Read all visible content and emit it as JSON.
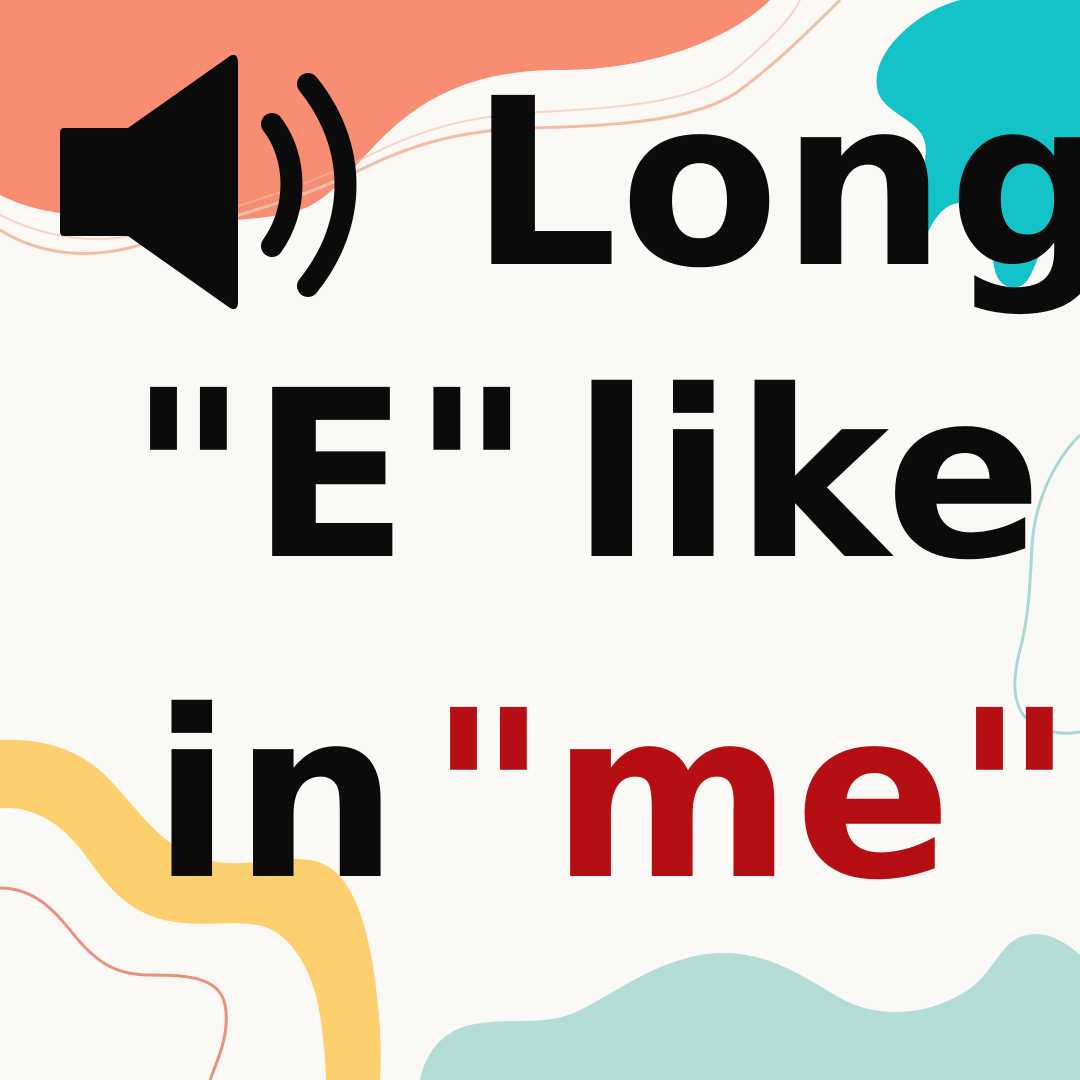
{
  "colors": {
    "background": "#fbf9f6",
    "coral_blob": "#f78d72",
    "teal_blob": "#14c3c8",
    "yellow_blob": "#fcd06f",
    "mint_blob": "#b3ddd6",
    "text": "#0b0b0b",
    "highlight": "#b50f14"
  },
  "icon": "speaker-volume-icon",
  "title": {
    "word1": "Long",
    "word2": "\"E\"",
    "word3": "like",
    "word4": "in",
    "word5": "\"me\""
  }
}
